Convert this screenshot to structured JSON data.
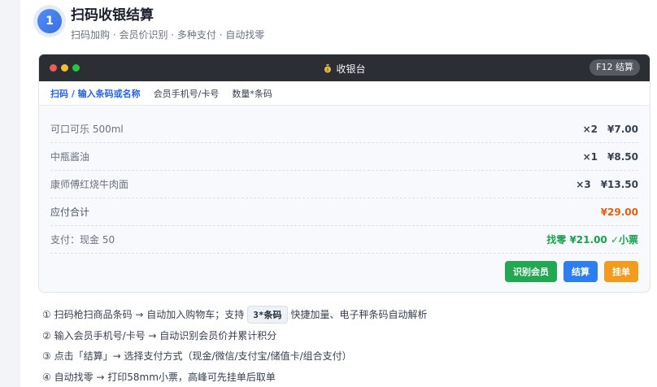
{
  "header": {
    "step_number": "1",
    "title": "扫码收银结算",
    "subtitle": "扫码加购 · 会员价识别 · 多种支付 · 自动找零"
  },
  "window": {
    "title": "收银台",
    "title_icon": "money-bag-icon",
    "shortcut_badge": "F12 结算"
  },
  "tabs": [
    {
      "label": "扫码 / 输入条码或名称",
      "active": true
    },
    {
      "label": "会员手机号/卡号",
      "active": false
    },
    {
      "label": "数量*条码",
      "active": false
    }
  ],
  "items": [
    {
      "name": "可口可乐 500ml",
      "qty": "×2",
      "price": "¥7.00"
    },
    {
      "name": "中瓶酱油",
      "qty": "×1",
      "price": "¥8.50"
    },
    {
      "name": "康师傅红烧牛肉面",
      "qty": "×3",
      "price": "¥13.50"
    }
  ],
  "total": {
    "label": "应付合计",
    "amount": "¥29.00"
  },
  "payment": {
    "label": "支付：现金 50",
    "change": "找零 ¥21.00 ✓小票"
  },
  "buttons": {
    "member": "识别会员",
    "checkout": "结算",
    "hold": "挂单"
  },
  "notes": {
    "n1_before": "① 扫码枪扫商品条码 → 自动加入购物车；支持",
    "n1_kbd": "3*条码",
    "n1_after": "快捷加量、电子秤条码自动解析",
    "n2": "② 输入会员手机号/卡号 → 自动识别会员价并累计积分",
    "n3": "③ 点击「结算」→ 选择支付方式（现金/微信/支付宝/储值卡/组合支付）",
    "n4": "④ 自动找零 → 打印58mm小票，高峰可先挂单后取单"
  },
  "colors": {
    "accent": "#2563eb",
    "total": "#e3600f",
    "change": "#16a34a",
    "member_button": "#22a852",
    "checkout_button": "#2d7ef0",
    "hold_button": "#f29b1d"
  }
}
